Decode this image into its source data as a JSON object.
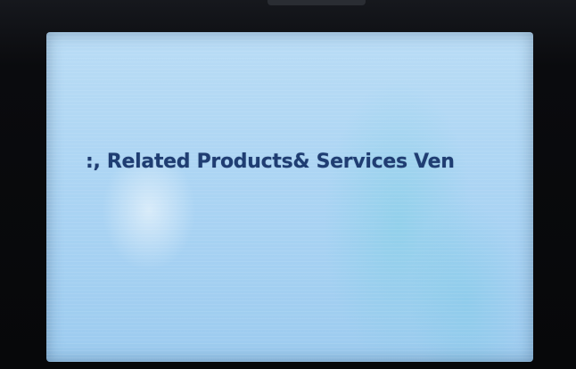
{
  "display": {
    "marquee_text": ":, Related Products& Services Ven"
  },
  "colors": {
    "screen_background": "#aed6f4",
    "text": "#1f3d72",
    "bezel": "#0a0b0e"
  }
}
